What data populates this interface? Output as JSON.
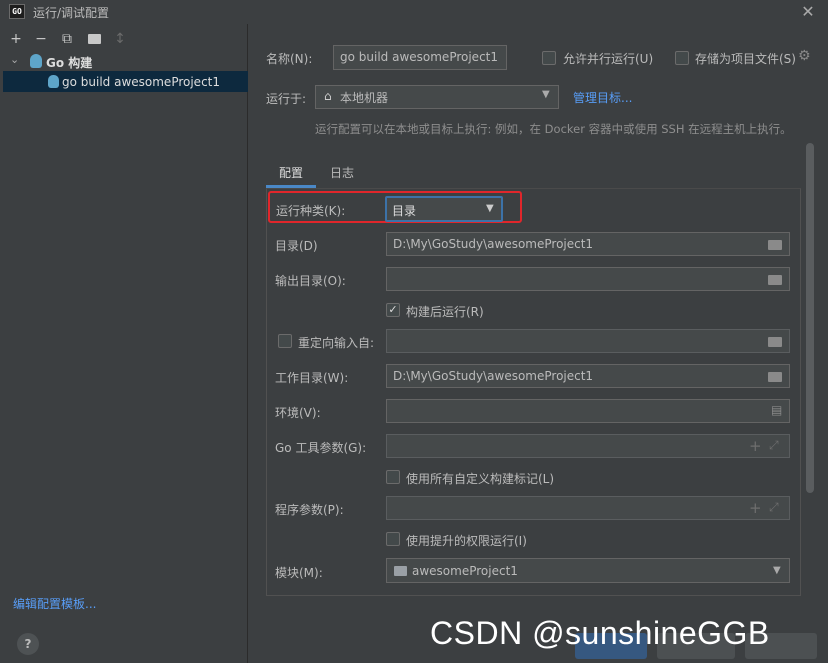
{
  "window": {
    "app_badge": "GO",
    "title": "运行/调试配置"
  },
  "left": {
    "toolbar": [
      "+",
      "−",
      "⧉",
      "▇",
      "↕"
    ],
    "group_label": "Go 构建",
    "item_label": "go build awesomeProject1",
    "edit_templates": "编辑配置模板...",
    "help": "?"
  },
  "form": {
    "name_label": "名称(N):",
    "name_value": "go build awesomeProject1",
    "parallel_label": "允许并行运行(U)",
    "store_label": "存储为项目文件(S)",
    "run_on_label": "运行于:",
    "run_on_value": "本地机器",
    "manage_targets": "管理目标...",
    "hint": "运行配置可以在本地或目标上执行: 例如，在 Docker 容器中或使用 SSH 在远程主机上执行。",
    "tabs": [
      "配置",
      "日志"
    ],
    "run_kind_label": "运行种类(K):",
    "run_kind_value": "目录",
    "dir_label": "目录(D)",
    "dir_value": "D:\\My\\GoStudy\\awesomeProject1",
    "output_dir_label": "输出目录(O):",
    "output_dir_value": "",
    "run_after_build_label": "构建后运行(R)",
    "redirect_label": "重定向输入自:",
    "work_dir_label": "工作目录(W):",
    "work_dir_value": "D:\\My\\GoStudy\\awesomeProject1",
    "env_label": "环境(V):",
    "go_tool_args_label": "Go 工具参数(G):",
    "custom_tags_label": "使用所有自定义构建标记(L)",
    "program_args_label": "程序参数(P):",
    "elevated_label": "使用提升的权限运行(I)",
    "module_label": "模块(M):",
    "module_value": "awesomeProject1"
  },
  "watermark": "CSDN @sunshineGGB",
  "colors": {
    "highlight": "#e0262b",
    "link": "#589df6",
    "selection": "#0d293e"
  }
}
